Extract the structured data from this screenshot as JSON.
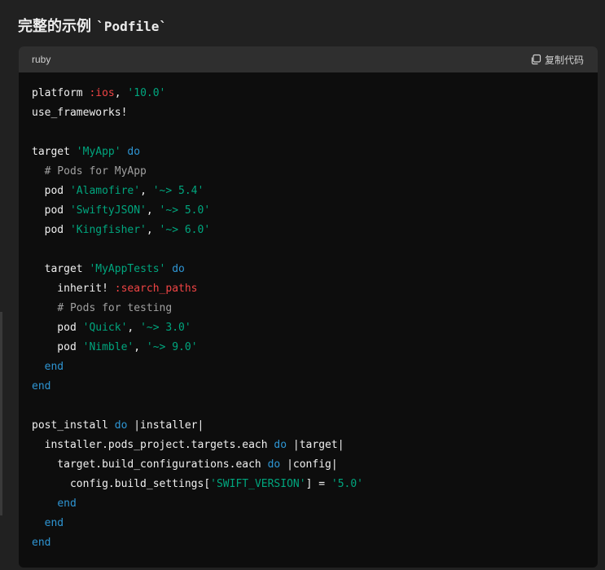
{
  "heading": {
    "prefix": "完整的示例 ",
    "code_word": "`Podfile`"
  },
  "code_block": {
    "language": "ruby",
    "copy_label": "复制代码",
    "lines": [
      [
        [
          "plain",
          "platform "
        ],
        [
          "sym",
          ":ios"
        ],
        [
          "plain",
          ", "
        ],
        [
          "str",
          "'10.0'"
        ]
      ],
      [
        [
          "plain",
          "use_frameworks!"
        ]
      ],
      [],
      [
        [
          "plain",
          "target "
        ],
        [
          "str",
          "'MyApp'"
        ],
        [
          "plain",
          " "
        ],
        [
          "kw",
          "do"
        ]
      ],
      [
        [
          "plain",
          "  "
        ],
        [
          "comment",
          "# Pods for MyApp"
        ]
      ],
      [
        [
          "plain",
          "  pod "
        ],
        [
          "str",
          "'Alamofire'"
        ],
        [
          "plain",
          ", "
        ],
        [
          "str",
          "'~> 5.4'"
        ]
      ],
      [
        [
          "plain",
          "  pod "
        ],
        [
          "str",
          "'SwiftyJSON'"
        ],
        [
          "plain",
          ", "
        ],
        [
          "str",
          "'~> 5.0'"
        ]
      ],
      [
        [
          "plain",
          "  pod "
        ],
        [
          "str",
          "'Kingfisher'"
        ],
        [
          "plain",
          ", "
        ],
        [
          "str",
          "'~> 6.0'"
        ]
      ],
      [],
      [
        [
          "plain",
          "  target "
        ],
        [
          "str",
          "'MyAppTests'"
        ],
        [
          "plain",
          " "
        ],
        [
          "kw",
          "do"
        ]
      ],
      [
        [
          "plain",
          "    inherit! "
        ],
        [
          "sym",
          ":search_paths"
        ]
      ],
      [
        [
          "plain",
          "    "
        ],
        [
          "comment",
          "# Pods for testing"
        ]
      ],
      [
        [
          "plain",
          "    pod "
        ],
        [
          "str",
          "'Quick'"
        ],
        [
          "plain",
          ", "
        ],
        [
          "str",
          "'~> 3.0'"
        ]
      ],
      [
        [
          "plain",
          "    pod "
        ],
        [
          "str",
          "'Nimble'"
        ],
        [
          "plain",
          ", "
        ],
        [
          "str",
          "'~> 9.0'"
        ]
      ],
      [
        [
          "plain",
          "  "
        ],
        [
          "kw",
          "end"
        ]
      ],
      [
        [
          "kw",
          "end"
        ]
      ],
      [],
      [
        [
          "plain",
          "post_install "
        ],
        [
          "kw",
          "do"
        ],
        [
          "plain",
          " |installer|"
        ]
      ],
      [
        [
          "plain",
          "  installer.pods_project.targets.each "
        ],
        [
          "kw",
          "do"
        ],
        [
          "plain",
          " |target|"
        ]
      ],
      [
        [
          "plain",
          "    target.build_configurations.each "
        ],
        [
          "kw",
          "do"
        ],
        [
          "plain",
          " |config|"
        ]
      ],
      [
        [
          "plain",
          "      config.build_settings["
        ],
        [
          "str",
          "'SWIFT_VERSION'"
        ],
        [
          "plain",
          "] = "
        ],
        [
          "str",
          "'5.0'"
        ]
      ],
      [
        [
          "plain",
          "    "
        ],
        [
          "kw",
          "end"
        ]
      ],
      [
        [
          "plain",
          "  "
        ],
        [
          "kw",
          "end"
        ]
      ],
      [
        [
          "kw",
          "end"
        ]
      ]
    ]
  },
  "icons": {
    "copy": "copy-icon"
  }
}
